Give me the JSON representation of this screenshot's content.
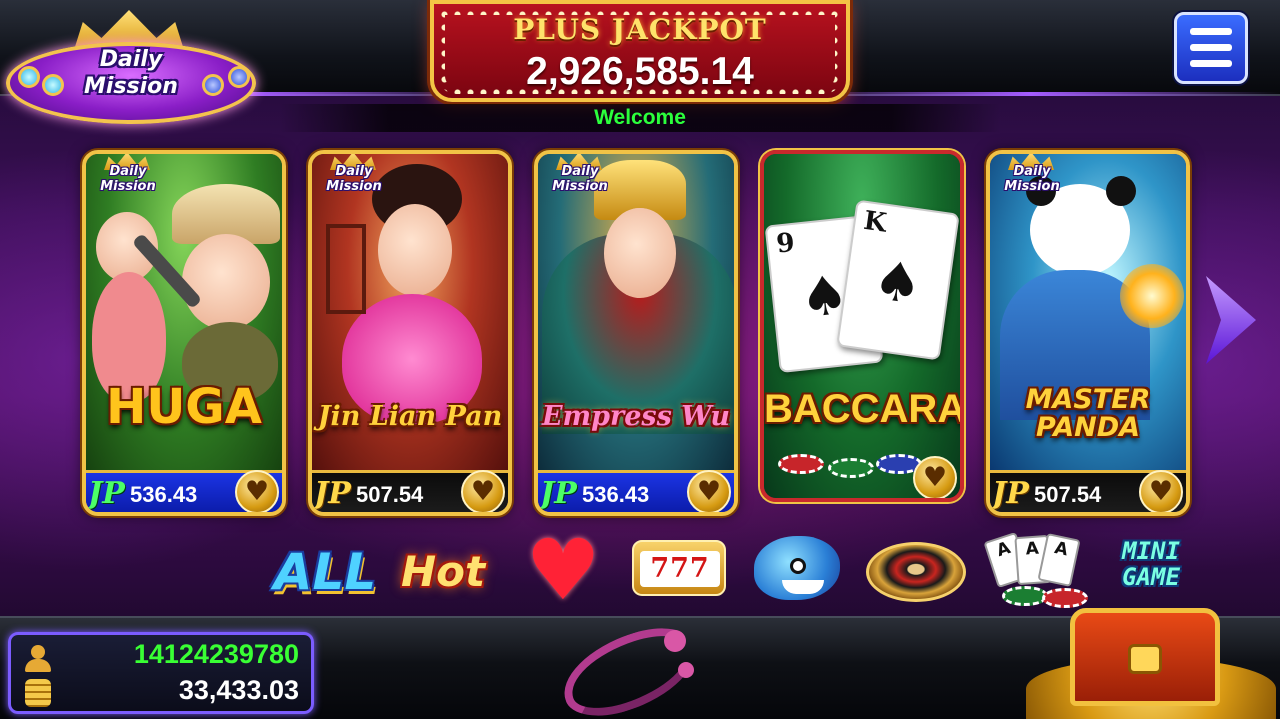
{
  "daily_mission": {
    "label_line1": "Daily",
    "label_line2": "Mission"
  },
  "jackpot": {
    "title": "PLUS JACKPOT",
    "amount": "2,926,585.14"
  },
  "welcome_text": "Welcome",
  "menu": {
    "icon": "hamburger-menu-icon"
  },
  "games": [
    {
      "name": "HUGA",
      "mission_line1": "Daily",
      "mission_line2": "Mission",
      "jp_label": "JP",
      "jp_value": "536.43",
      "jp_style": "blue",
      "fav_icon": "heart-icon"
    },
    {
      "name": "Jin Lian Pan",
      "mission_line1": "Daily",
      "mission_line2": "Mission",
      "jp_label": "JP",
      "jp_value": "507.54",
      "jp_style": "black",
      "fav_icon": "heart-icon"
    },
    {
      "name": "Empress Wu",
      "mission_line1": "Daily",
      "mission_line2": "Mission",
      "jp_label": "JP",
      "jp_value": "536.43",
      "jp_style": "blue",
      "fav_icon": "heart-icon"
    },
    {
      "name": "BACCARAT",
      "card1_rank": "9",
      "card2_rank": "K",
      "suit": "♠",
      "fav_icon": "heart-icon"
    },
    {
      "name": "MASTER PANDA",
      "mission_line1": "Daily",
      "mission_line2": "Mission",
      "jp_label": "JP",
      "jp_value": "507.54",
      "jp_style": "black",
      "fav_icon": "heart-icon"
    }
  ],
  "categories": {
    "all": "ALL",
    "hot": "Hot",
    "favorite_icon": "heart-icon",
    "slot_label": "777",
    "fish_icon": "shark-icon",
    "roulette_icon": "roulette-icon",
    "cards": [
      "A",
      "A",
      "A"
    ],
    "mini_game_line1": "MINI",
    "mini_game_line2": "GAME"
  },
  "player": {
    "user_id": "14124239780",
    "balance": "33,433.03"
  },
  "colors": {
    "accent_gold": "#f1c346",
    "welcome_green": "#2bff3c",
    "uid_green": "#39ff34",
    "jp_blue": "#1b34e4"
  }
}
